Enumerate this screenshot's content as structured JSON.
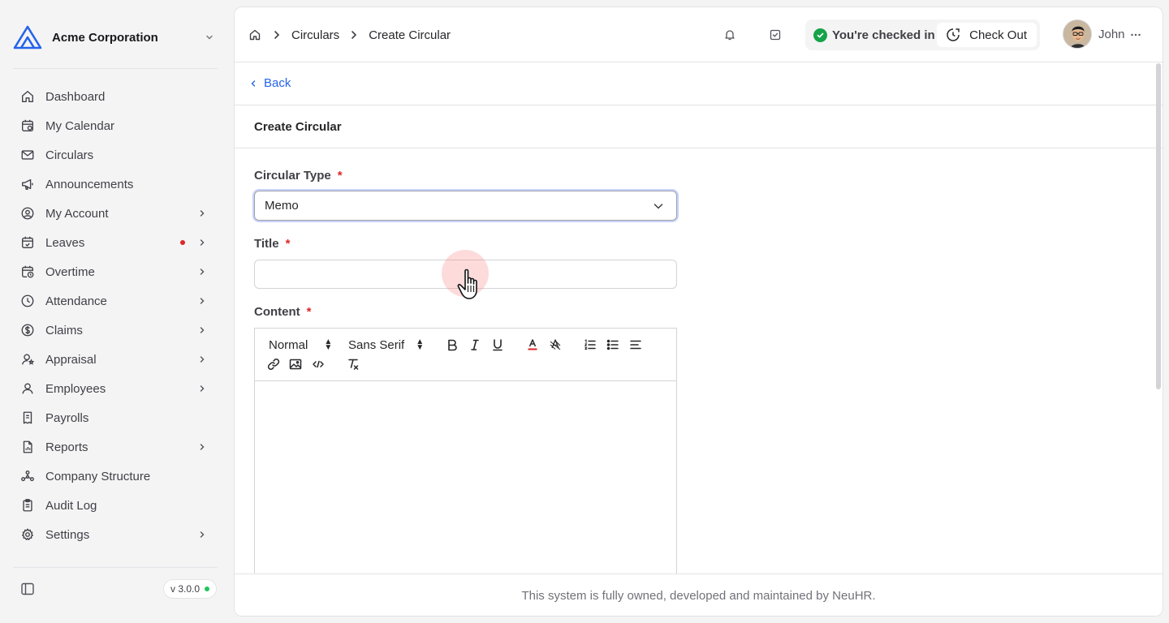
{
  "org": {
    "name": "Acme Corporation",
    "logo_color": "#2563eb"
  },
  "sidebar": {
    "items": [
      {
        "label": "Dashboard",
        "icon": "home-icon",
        "chevron": false,
        "dot": false
      },
      {
        "label": "My Calendar",
        "icon": "calendar-icon",
        "chevron": false,
        "dot": false
      },
      {
        "label": "Circulars",
        "icon": "mail-icon",
        "chevron": false,
        "dot": false
      },
      {
        "label": "Announcements",
        "icon": "megaphone-icon",
        "chevron": false,
        "dot": false
      },
      {
        "label": "My Account",
        "icon": "user-circle-icon",
        "chevron": true,
        "dot": false
      },
      {
        "label": "Leaves",
        "icon": "calendar-check-icon",
        "chevron": true,
        "dot": true
      },
      {
        "label": "Overtime",
        "icon": "calendar-clock-icon",
        "chevron": true,
        "dot": false
      },
      {
        "label": "Attendance",
        "icon": "clock-icon",
        "chevron": true,
        "dot": false
      },
      {
        "label": "Claims",
        "icon": "dollar-circle-icon",
        "chevron": true,
        "dot": false
      },
      {
        "label": "Appraisal",
        "icon": "user-star-icon",
        "chevron": true,
        "dot": false
      },
      {
        "label": "Employees",
        "icon": "user-icon",
        "chevron": true,
        "dot": false
      },
      {
        "label": "Payrolls",
        "icon": "receipt-icon",
        "chevron": false,
        "dot": false
      },
      {
        "label": "Reports",
        "icon": "file-chart-icon",
        "chevron": true,
        "dot": false
      },
      {
        "label": "Company Structure",
        "icon": "network-icon",
        "chevron": false,
        "dot": false
      },
      {
        "label": "Audit Log",
        "icon": "clipboard-icon",
        "chevron": false,
        "dot": false
      },
      {
        "label": "Settings",
        "icon": "gear-icon",
        "chevron": true,
        "dot": false
      }
    ],
    "version": "v 3.0.0",
    "version_status_color": "#22c55e",
    "alert_dot_color": "#dc2626"
  },
  "breadcrumb": {
    "items": [
      "Circulars",
      "Create Circular"
    ]
  },
  "header": {
    "checkin_text": "You're checked in",
    "checkout_label": "Check Out",
    "user_name": "John"
  },
  "page": {
    "back_label": "Back",
    "title": "Create Circular"
  },
  "form": {
    "type_label": "Circular Type",
    "type_value": "Memo",
    "title_label": "Title",
    "title_value": "",
    "content_label": "Content",
    "required_mark": "*",
    "editor": {
      "format_value": "Normal",
      "font_value": "Sans Serif",
      "content": ""
    }
  },
  "footer": {
    "text": "This system is fully owned, developed and maintained by NeuHR."
  },
  "colors": {
    "link": "#2563eb",
    "success": "#16a34a",
    "required": "#dc2626"
  }
}
